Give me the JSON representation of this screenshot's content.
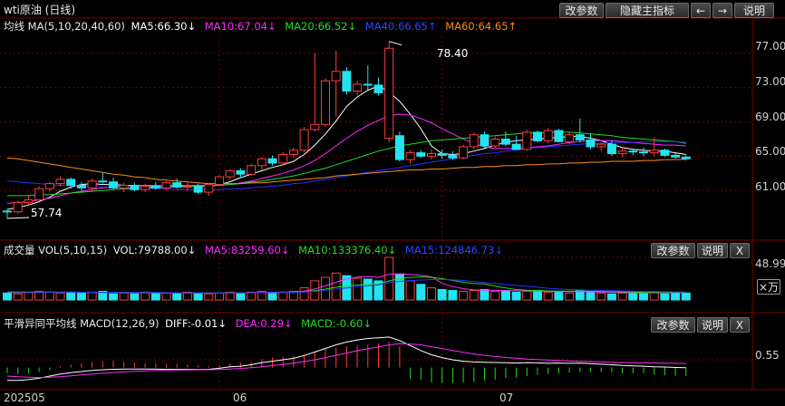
{
  "header": {
    "title": "wti原油 (日线)",
    "buttons": {
      "params": "改参数",
      "hide": "隐藏主指标",
      "left": "←",
      "right": "→",
      "help": "说明"
    }
  },
  "price_panel": {
    "legend": {
      "name": "均线 MA(5,10,20,40,60)",
      "ma5": "MA5:66.30↓",
      "ma10": "MA10:67.04↓",
      "ma20": "MA20:66.52↓",
      "ma40": "MA40:66.65↑",
      "ma60": "MA60:64.65↑"
    },
    "annotations": {
      "high": "78.40",
      "low": "57.74"
    },
    "y_ticks": [
      "77.00",
      "73.00",
      "69.00",
      "65.00",
      "61.00"
    ]
  },
  "volume_panel": {
    "legend": {
      "name": "成交量 VOL(5,10,15)",
      "vol": "VOL:79788.00↓",
      "ma5": "MA5:83259.60↓",
      "ma10": "MA10:133376.40↓",
      "ma15": "MA15:124846.73↓"
    },
    "buttons": {
      "params": "改参数",
      "help": "说明",
      "close": "X"
    },
    "y_tick": "48.99",
    "unit_label": "×万"
  },
  "macd_panel": {
    "legend": {
      "name": "平滑异同平均线 MACD(12,26,9)",
      "diff": "DIFF:-0.01↓",
      "dea": "DEA:0.29↓",
      "macd": "MACD:-0.60↓"
    },
    "buttons": {
      "params": "改参数",
      "help": "说明",
      "close": "X"
    },
    "y_tick": "0.55"
  },
  "x_axis": {
    "labels": [
      "202505",
      "06",
      "07"
    ]
  },
  "colors": {
    "up": "#ff3c3c",
    "down": "#22e3ef",
    "ma5": "#ffffff",
    "ma10": "#ff2aff",
    "ma20": "#22dd22",
    "ma40": "#2233ff",
    "ma60": "#ff8c1a",
    "grid": "#7a0000"
  },
  "chart_data": {
    "type": "candlestick",
    "title": "wti原油 (日线)",
    "y_range": [
      57.0,
      79.0
    ],
    "y_ticks": [
      77,
      73,
      69,
      65,
      61
    ],
    "x_labels": [
      {
        "index": 0,
        "label": "202505"
      },
      {
        "index": 20,
        "label": "06"
      },
      {
        "index": 41,
        "label": "07"
      }
    ],
    "candles": [
      [
        58.6,
        58.8,
        57.74,
        58.5
      ],
      [
        58.5,
        59.8,
        58.3,
        59.6
      ],
      [
        59.6,
        60.5,
        59.3,
        59.9
      ],
      [
        59.9,
        61.5,
        59.8,
        61.2
      ],
      [
        61.2,
        62.0,
        60.9,
        61.8
      ],
      [
        61.8,
        62.6,
        61.5,
        62.3
      ],
      [
        62.3,
        62.5,
        61.2,
        61.6
      ],
      [
        61.6,
        62.0,
        60.9,
        61.3
      ],
      [
        61.3,
        62.4,
        61.0,
        62.1
      ],
      [
        62.1,
        63.1,
        61.8,
        62.0
      ],
      [
        62.0,
        62.5,
        61.1,
        61.3
      ],
      [
        61.3,
        61.9,
        60.8,
        61.6
      ],
      [
        61.6,
        61.9,
        60.9,
        61.1
      ],
      [
        61.1,
        61.8,
        60.8,
        61.5
      ],
      [
        61.5,
        62.0,
        61.1,
        61.3
      ],
      [
        61.3,
        62.1,
        61.0,
        61.9
      ],
      [
        61.9,
        62.4,
        61.2,
        61.4
      ],
      [
        61.4,
        61.9,
        60.9,
        61.5
      ],
      [
        61.5,
        61.8,
        60.6,
        60.8
      ],
      [
        60.8,
        61.9,
        60.4,
        61.7
      ],
      [
        61.7,
        62.8,
        61.6,
        62.6
      ],
      [
        62.6,
        63.5,
        62.3,
        63.3
      ],
      [
        63.3,
        63.6,
        62.5,
        62.9
      ],
      [
        62.9,
        64.1,
        62.7,
        63.9
      ],
      [
        63.9,
        64.9,
        63.4,
        64.7
      ],
      [
        64.7,
        65.1,
        63.9,
        64.2
      ],
      [
        64.2,
        65.5,
        64.0,
        65.2
      ],
      [
        65.2,
        66.0,
        64.8,
        65.7
      ],
      [
        65.7,
        68.4,
        65.4,
        68.1
      ],
      [
        68.1,
        77.1,
        67.9,
        68.7
      ],
      [
        68.7,
        74.1,
        68.4,
        73.8
      ],
      [
        73.8,
        77.3,
        69.6,
        74.9
      ],
      [
        74.9,
        75.4,
        72.2,
        72.6
      ],
      [
        72.6,
        73.8,
        72.1,
        73.4
      ],
      [
        73.4,
        75.6,
        72.7,
        73.3
      ],
      [
        73.3,
        74.2,
        72.1,
        72.4
      ],
      [
        67.1,
        78.4,
        66.6,
        77.6
      ],
      [
        67.4,
        67.9,
        64.4,
        64.6
      ],
      [
        64.6,
        65.7,
        64.1,
        65.4
      ],
      [
        65.4,
        65.7,
        64.8,
        65.0
      ],
      [
        65.0,
        65.8,
        64.6,
        65.3
      ],
      [
        65.3,
        65.8,
        64.7,
        65.1
      ],
      [
        65.1,
        65.6,
        64.6,
        64.8
      ],
      [
        64.8,
        66.3,
        64.6,
        66.1
      ],
      [
        66.1,
        67.8,
        65.8,
        67.5
      ],
      [
        67.5,
        67.9,
        65.9,
        66.2
      ],
      [
        66.2,
        67.3,
        66.0,
        67.0
      ],
      [
        67.0,
        67.9,
        66.2,
        66.4
      ],
      [
        66.4,
        67.4,
        65.8,
        65.8
      ],
      [
        65.8,
        68.1,
        65.6,
        67.8
      ],
      [
        67.8,
        68.0,
        66.6,
        66.8
      ],
      [
        66.8,
        68.3,
        66.5,
        68.0
      ],
      [
        68.0,
        68.2,
        66.7,
        66.7
      ],
      [
        66.7,
        67.9,
        66.4,
        67.5
      ],
      [
        67.5,
        69.4,
        66.6,
        66.9
      ],
      [
        66.9,
        67.6,
        65.8,
        66.1
      ],
      [
        66.1,
        66.6,
        65.6,
        66.4
      ],
      [
        66.4,
        66.9,
        65.0,
        65.3
      ],
      [
        65.3,
        66.1,
        64.9,
        65.6
      ],
      [
        65.6,
        65.9,
        65.1,
        65.5
      ],
      [
        65.5,
        66.0,
        65.0,
        65.4
      ],
      [
        65.4,
        67.2,
        65.0,
        65.7
      ],
      [
        65.7,
        65.9,
        64.9,
        65.1
      ],
      [
        65.1,
        65.4,
        64.7,
        64.9
      ],
      [
        64.9,
        65.1,
        64.5,
        64.7
      ]
    ],
    "ma_series": [
      {
        "name": "MA5",
        "values": [
          58.8,
          59.0,
          59.3,
          59.7,
          60.2,
          60.9,
          61.4,
          61.7,
          61.8,
          61.7,
          61.7,
          61.6,
          61.6,
          61.5,
          61.4,
          61.4,
          61.5,
          61.5,
          61.5,
          61.5,
          61.7,
          62.0,
          62.5,
          62.9,
          63.3,
          63.7,
          64.0,
          64.4,
          65.2,
          66.3,
          67.6,
          69.1,
          70.8,
          71.9,
          72.7,
          73.2,
          72.5,
          71.4,
          69.9,
          68.2,
          66.2,
          65.3,
          65.2,
          65.3,
          65.6,
          65.9,
          66.3,
          66.6,
          66.8,
          66.9,
          67.0,
          67.1,
          67.2,
          67.3,
          67.3,
          67.1,
          66.8,
          66.4,
          66.0,
          65.8,
          65.7,
          65.6,
          65.6,
          65.4,
          65.2
        ]
      },
      {
        "name": "MA10",
        "values": [
          59.5,
          59.6,
          59.7,
          59.9,
          60.1,
          60.4,
          60.7,
          60.9,
          61.1,
          61.3,
          61.4,
          61.5,
          61.6,
          61.6,
          61.6,
          61.6,
          61.6,
          61.6,
          61.6,
          61.6,
          61.6,
          61.7,
          61.9,
          62.1,
          62.4,
          62.7,
          63.0,
          63.4,
          63.9,
          64.5,
          65.3,
          66.2,
          67.1,
          67.9,
          68.6,
          69.2,
          69.7,
          69.9,
          69.8,
          69.4,
          68.9,
          68.2,
          67.6,
          67.0,
          66.5,
          66.1,
          65.9,
          65.9,
          65.9,
          66.0,
          66.1,
          66.2,
          66.4,
          66.6,
          66.7,
          66.8,
          66.8,
          66.8,
          66.7,
          66.6,
          66.5,
          66.4,
          66.3,
          66.3,
          66.2
        ]
      },
      {
        "name": "MA20",
        "values": [
          60.4,
          60.4,
          60.4,
          60.5,
          60.5,
          60.6,
          60.7,
          60.8,
          60.9,
          61.0,
          61.1,
          61.2,
          61.2,
          61.3,
          61.3,
          61.4,
          61.4,
          61.5,
          61.5,
          61.5,
          61.6,
          61.7,
          61.8,
          62.0,
          62.1,
          62.3,
          62.5,
          62.7,
          63.0,
          63.3,
          63.6,
          64.0,
          64.4,
          64.8,
          65.2,
          65.6,
          65.9,
          66.2,
          66.4,
          66.6,
          66.8,
          66.9,
          67.0,
          67.1,
          67.2,
          67.3,
          67.4,
          67.5,
          67.6,
          67.7,
          67.7,
          67.8,
          67.8,
          67.8,
          67.7,
          67.6,
          67.5,
          67.4,
          67.2,
          67.1,
          67.0,
          66.9,
          66.8,
          66.7,
          66.5
        ]
      },
      {
        "name": "MA40",
        "values": [
          62.1,
          62.0,
          61.9,
          61.8,
          61.7,
          61.6,
          61.6,
          61.5,
          61.5,
          61.4,
          61.4,
          61.3,
          61.3,
          61.2,
          61.2,
          61.2,
          61.1,
          61.1,
          61.1,
          61.1,
          61.1,
          61.2,
          61.2,
          61.3,
          61.4,
          61.5,
          61.6,
          61.8,
          61.9,
          62.1,
          62.3,
          62.5,
          62.7,
          62.9,
          63.1,
          63.3,
          63.5,
          63.7,
          63.9,
          64.1,
          64.3,
          64.5,
          64.7,
          64.9,
          65.1,
          65.3,
          65.4,
          65.6,
          65.7,
          65.9,
          66.0,
          66.1,
          66.2,
          66.3,
          66.4,
          66.5,
          66.5,
          66.6,
          66.6,
          66.6,
          66.7,
          66.7,
          66.7,
          66.7,
          66.6
        ]
      },
      {
        "name": "MA60",
        "values": [
          64.8,
          64.7,
          64.5,
          64.3,
          64.1,
          63.9,
          63.7,
          63.5,
          63.3,
          63.1,
          62.9,
          62.8,
          62.6,
          62.5,
          62.3,
          62.2,
          62.1,
          62.0,
          61.9,
          61.8,
          61.8,
          61.8,
          61.8,
          61.9,
          61.9,
          62.0,
          62.1,
          62.2,
          62.3,
          62.4,
          62.5,
          62.7,
          62.8,
          62.9,
          63.0,
          63.1,
          63.2,
          63.3,
          63.4,
          63.4,
          63.5,
          63.5,
          63.6,
          63.7,
          63.7,
          63.8,
          63.8,
          63.9,
          63.9,
          64.0,
          64.0,
          64.1,
          64.1,
          64.2,
          64.2,
          64.3,
          64.3,
          64.4,
          64.4,
          64.4,
          64.5,
          64.5,
          64.6,
          64.6,
          64.65
        ]
      }
    ],
    "volume_max": 48.99,
    "volumes": [
      8,
      7,
      9,
      10,
      9,
      8,
      9,
      8,
      9,
      10,
      7,
      8,
      7,
      9,
      8,
      8,
      7,
      9,
      8,
      7,
      8,
      9,
      8,
      9,
      10,
      8,
      9,
      10,
      14,
      22,
      26,
      31,
      28,
      25,
      24,
      22,
      48.99,
      30,
      22,
      18,
      14,
      12,
      11,
      10,
      11,
      12,
      10,
      11,
      9,
      10,
      11,
      9,
      10,
      8,
      11,
      9,
      8,
      7,
      8,
      9,
      8,
      9,
      7,
      8,
      7.98
    ],
    "volume_ma": [
      {
        "name": "MA5",
        "values": [
          8.5,
          8.4,
          8.5,
          8.7,
          8.9,
          9.0,
          9.0,
          8.8,
          8.6,
          8.8,
          8.6,
          8.4,
          8.2,
          8.2,
          8.0,
          7.9,
          7.9,
          8.0,
          8.0,
          7.9,
          8.0,
          8.2,
          8.2,
          8.4,
          8.8,
          8.9,
          9.0,
          9.2,
          10.2,
          12.6,
          16.2,
          20.4,
          24.2,
          26.4,
          26.8,
          26.0,
          29.6,
          30.0,
          29.4,
          28.4,
          26.6,
          19.2,
          15.4,
          13.0,
          11.6,
          11.2,
          10.8,
          10.8,
          10.6,
          10.4,
          10.2,
          10.0,
          9.8,
          9.6,
          9.6,
          9.4,
          9.2,
          8.8,
          8.6,
          8.2,
          8.0,
          8.2,
          8.2,
          8.2,
          8.3
        ]
      },
      {
        "name": "MA10",
        "values": [
          9.0,
          9.0,
          9.0,
          9.0,
          9.0,
          8.9,
          8.9,
          8.8,
          8.8,
          8.8,
          8.7,
          8.6,
          8.5,
          8.4,
          8.4,
          8.3,
          8.2,
          8.1,
          8.1,
          8.0,
          8.0,
          8.0,
          8.1,
          8.2,
          8.3,
          8.4,
          8.6,
          8.8,
          9.4,
          10.6,
          12.5,
          14.6,
          16.2,
          17.2,
          17.8,
          18.4,
          22.0,
          24.5,
          26.0,
          26.6,
          26.1,
          24.5,
          22.5,
          20.3,
          18.9,
          18.6,
          15.9,
          13.8,
          12.0,
          11.3,
          10.8,
          10.4,
          10.2,
          10.1,
          10.1,
          10.0,
          9.8,
          9.5,
          9.4,
          9.2,
          8.8,
          8.7,
          8.6,
          8.5,
          8.4
        ]
      },
      {
        "name": "MA15",
        "values": [
          9.5,
          9.4,
          9.3,
          9.2,
          9.1,
          9.0,
          9.0,
          8.9,
          8.9,
          8.8,
          8.8,
          8.7,
          8.6,
          8.6,
          8.5,
          8.4,
          8.3,
          8.3,
          8.2,
          8.2,
          8.1,
          8.2,
          8.2,
          8.3,
          8.3,
          8.4,
          8.5,
          8.7,
          9.1,
          9.9,
          11.0,
          12.6,
          13.9,
          15.2,
          16.4,
          17.3,
          19.9,
          21.4,
          22.3,
          22.9,
          23.5,
          23.5,
          23.1,
          22.4,
          21.1,
          20.1,
          19.1,
          17.8,
          16.7,
          15.6,
          14.7,
          13.4,
          12.6,
          12.0,
          11.6,
          11.3,
          10.9,
          10.6,
          10.3,
          10.1,
          9.9,
          9.7,
          9.5,
          9.3,
          9.2
        ]
      }
    ],
    "macd": {
      "range": [
        -1.3,
        2.4
      ],
      "diff": [
        -0.9,
        -0.9,
        -0.85,
        -0.75,
        -0.6,
        -0.45,
        -0.35,
        -0.28,
        -0.2,
        -0.15,
        -0.12,
        -0.1,
        -0.1,
        -0.1,
        -0.1,
        -0.12,
        -0.12,
        -0.12,
        -0.14,
        -0.12,
        -0.05,
        0.05,
        0.1,
        0.2,
        0.35,
        0.45,
        0.55,
        0.65,
        0.85,
        1.1,
        1.35,
        1.6,
        1.8,
        1.95,
        2.05,
        2.1,
        2.15,
        1.9,
        1.55,
        1.2,
        0.9,
        0.7,
        0.55,
        0.45,
        0.4,
        0.38,
        0.36,
        0.34,
        0.32,
        0.35,
        0.33,
        0.3,
        0.32,
        0.3,
        0.32,
        0.28,
        0.24,
        0.2,
        0.15,
        0.12,
        0.1,
        0.06,
        0.04,
        0.01,
        -0.01
      ],
      "dea": [
        -0.6,
        -0.65,
        -0.68,
        -0.7,
        -0.68,
        -0.64,
        -0.58,
        -0.52,
        -0.46,
        -0.4,
        -0.35,
        -0.3,
        -0.26,
        -0.23,
        -0.2,
        -0.18,
        -0.17,
        -0.16,
        -0.16,
        -0.15,
        -0.13,
        -0.1,
        -0.06,
        -0.01,
        0.06,
        0.14,
        0.22,
        0.31,
        0.42,
        0.55,
        0.7,
        0.86,
        1.03,
        1.19,
        1.33,
        1.45,
        1.6,
        1.68,
        1.66,
        1.6,
        1.47,
        1.35,
        1.2,
        1.08,
        0.96,
        0.86,
        0.78,
        0.71,
        0.66,
        0.6,
        0.57,
        0.53,
        0.5,
        0.47,
        0.45,
        0.42,
        0.4,
        0.37,
        0.35,
        0.34,
        0.33,
        0.32,
        0.31,
        0.3,
        0.29
      ],
      "hist": [
        -0.4,
        -0.45,
        -0.4,
        -0.3,
        -0.15,
        0.1,
        0.2,
        0.3,
        0.4,
        0.45,
        0.5,
        0.4,
        0.35,
        0.3,
        0.3,
        0.25,
        0.25,
        0.2,
        0.15,
        0.1,
        0.15,
        0.3,
        0.35,
        0.4,
        0.6,
        0.7,
        0.75,
        0.8,
        0.9,
        1.1,
        1.3,
        1.4,
        1.5,
        1.55,
        1.6,
        1.7,
        1.8,
        1.5,
        -0.8,
        -0.85,
        -1.05,
        -1.1,
        -1.1,
        -1.05,
        -1.0,
        -0.9,
        -0.85,
        -0.75,
        -0.7,
        -0.6,
        -0.5,
        -0.45,
        -0.4,
        -0.35,
        -0.3,
        -0.3,
        -0.3,
        -0.35,
        -0.4,
        -0.4,
        -0.4,
        -0.5,
        -0.55,
        -0.58,
        -0.6
      ]
    }
  }
}
